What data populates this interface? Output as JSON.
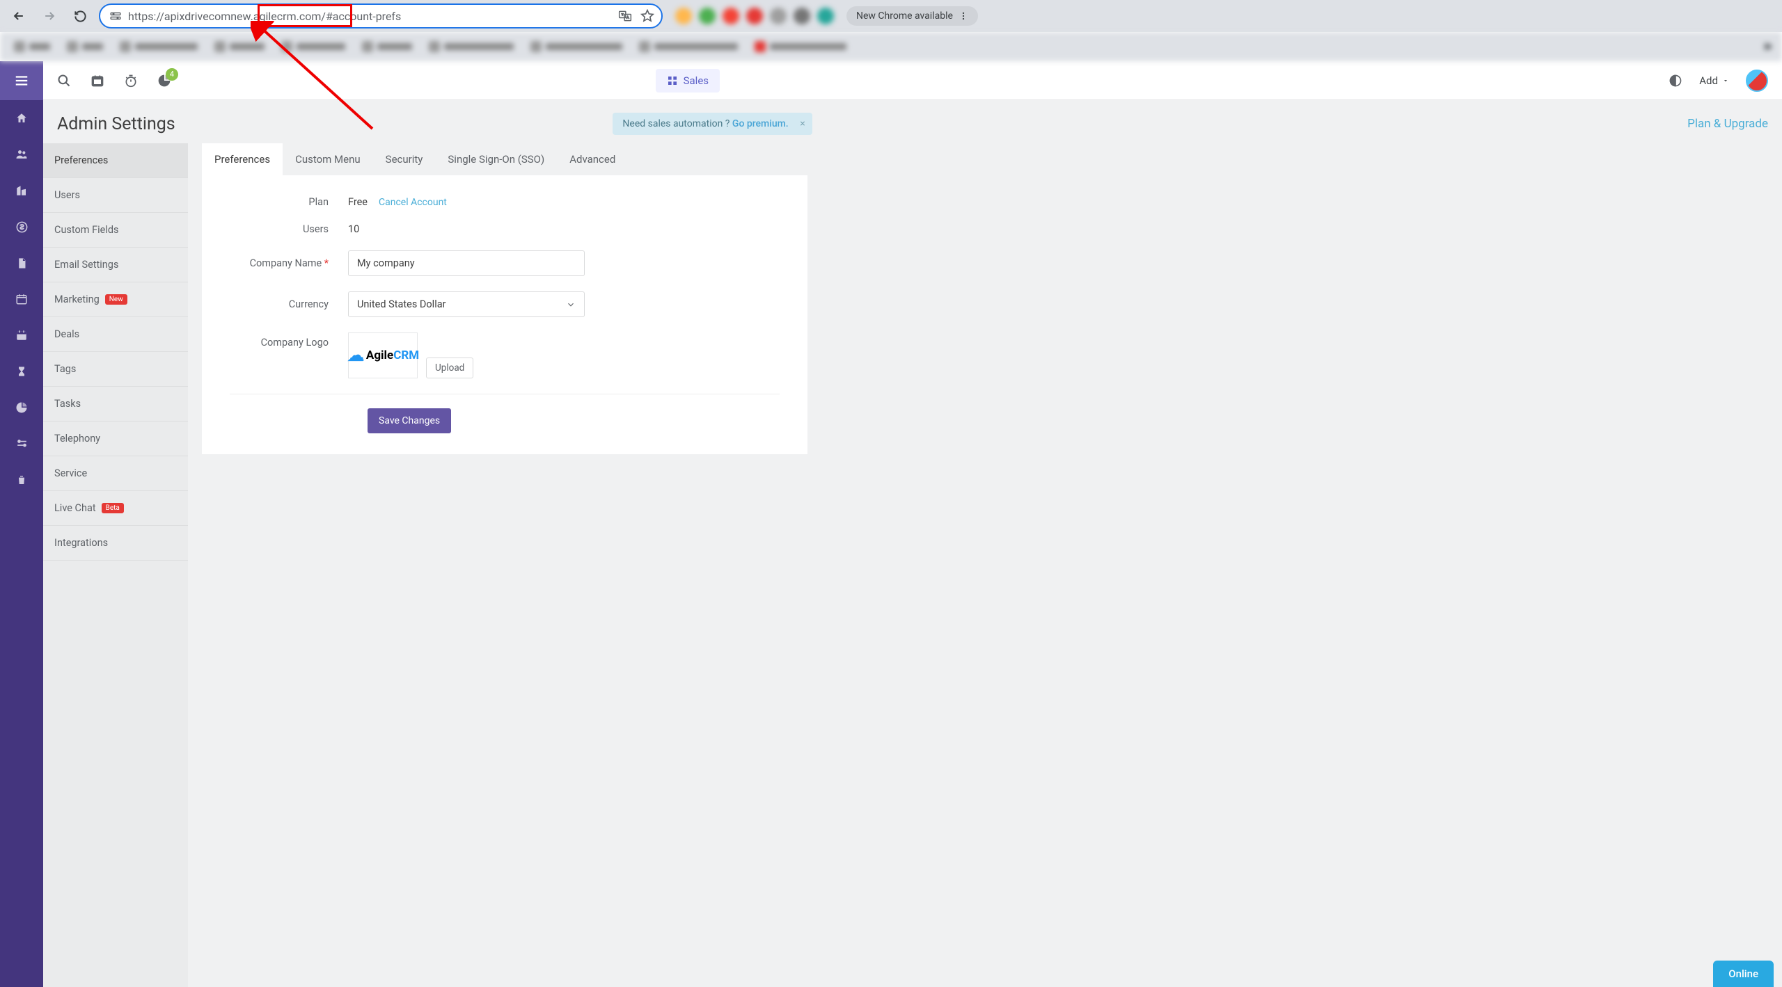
{
  "browser": {
    "url_prefix": "https://",
    "url_subdomain": "apixdrivecomnew",
    "url_rest": ".agilecrm.com/#account-prefs",
    "new_chrome_label": "New Chrome available"
  },
  "topbar": {
    "badge_count": "4",
    "sales_label": "Sales",
    "add_label": "Add"
  },
  "page": {
    "title": "Admin Settings",
    "promo_text": "Need sales automation ?",
    "promo_link": "Go premium.",
    "plan_upgrade": "Plan & Upgrade"
  },
  "settings_nav": {
    "items": [
      {
        "label": "Preferences",
        "active": true
      },
      {
        "label": "Users"
      },
      {
        "label": "Custom Fields"
      },
      {
        "label": "Email Settings"
      },
      {
        "label": "Marketing",
        "badge": "New"
      },
      {
        "label": "Deals"
      },
      {
        "label": "Tags"
      },
      {
        "label": "Tasks"
      },
      {
        "label": "Telephony"
      },
      {
        "label": "Service"
      },
      {
        "label": "Live Chat",
        "badge": "Beta"
      },
      {
        "label": "Integrations"
      }
    ]
  },
  "tabs": [
    {
      "label": "Preferences",
      "active": true
    },
    {
      "label": "Custom Menu"
    },
    {
      "label": "Security"
    },
    {
      "label": "Single Sign-On (SSO)"
    },
    {
      "label": "Advanced"
    }
  ],
  "form": {
    "plan_label": "Plan",
    "plan_value": "Free",
    "cancel_account": "Cancel Account",
    "users_label": "Users",
    "users_value": "10",
    "company_name_label": "Company Name",
    "company_name_value": "My company",
    "currency_label": "Currency",
    "currency_value": "United States Dollar",
    "logo_label": "Company Logo",
    "upload_label": "Upload",
    "save_label": "Save Changes"
  },
  "online_label": "Online"
}
